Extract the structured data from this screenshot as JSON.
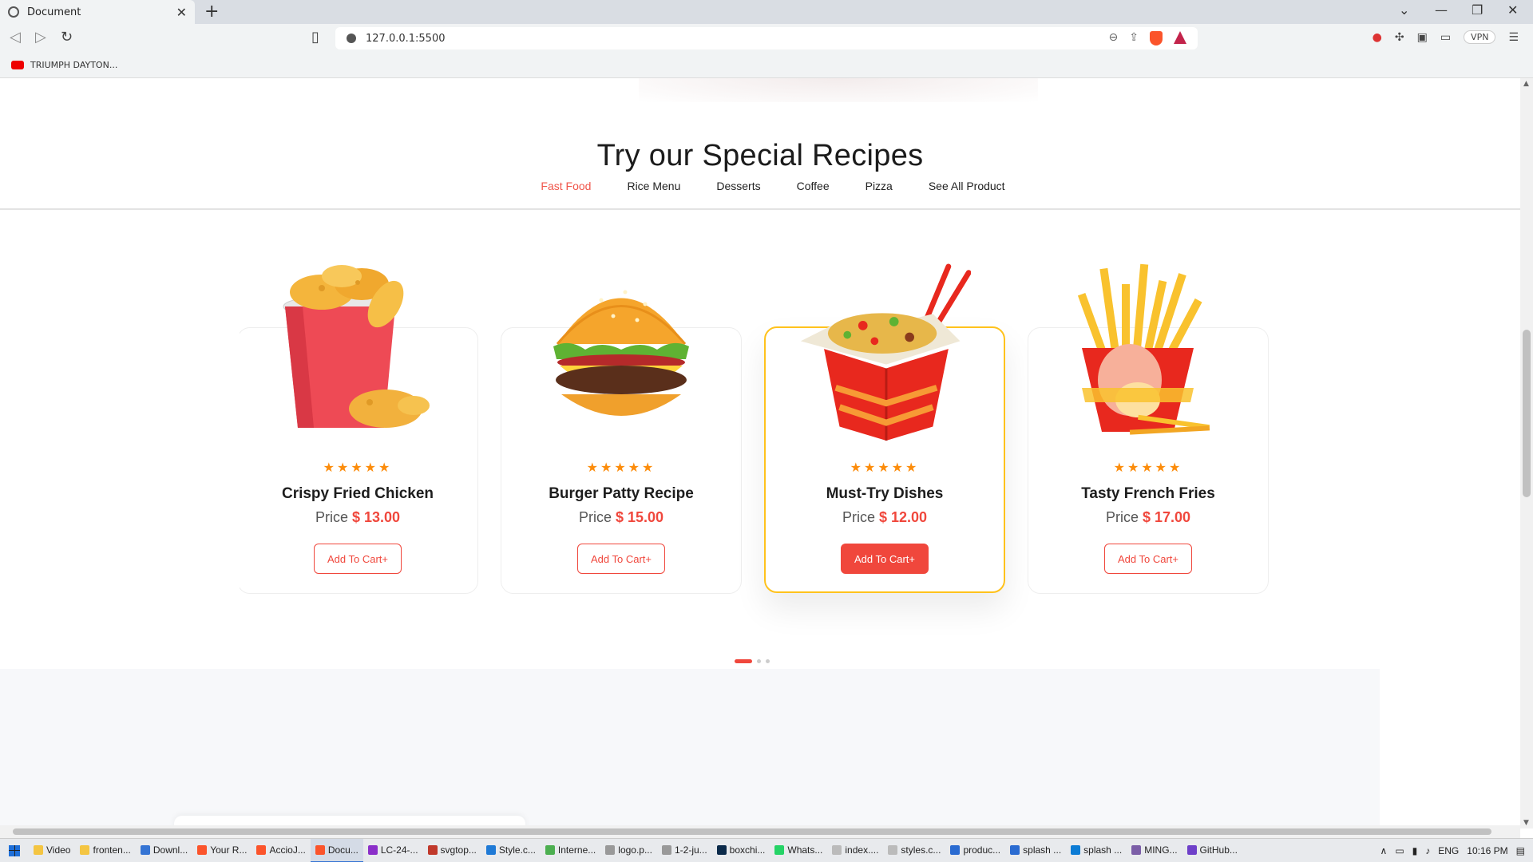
{
  "browser": {
    "tab_title": "Document",
    "url": "127.0.0.1:5500",
    "vpn_label": "VPN",
    "bookmark": "TRIUMPH DAYTON..."
  },
  "section": {
    "title": "Try our Special Recipes",
    "filters": [
      {
        "label": "Fast Food",
        "active": true
      },
      {
        "label": "Rice Menu",
        "active": false
      },
      {
        "label": "Desserts",
        "active": false
      },
      {
        "label": "Coffee",
        "active": false
      },
      {
        "label": "Pizza",
        "active": false
      },
      {
        "label": "See All Product",
        "active": false
      }
    ]
  },
  "products": [
    {
      "name": "Crispy Fried Chicken",
      "price_label": "Price",
      "price": "$ 13.00",
      "rating": 5,
      "button": "Add To Cart+",
      "image": "fried-chicken-bucket"
    },
    {
      "name": "Burger Patty Recipe",
      "price_label": "Price",
      "price": "$ 15.00",
      "rating": 5,
      "button": "Add To Cart+",
      "image": "burger"
    },
    {
      "name": "Must-Try Dishes",
      "price_label": "Price",
      "price": "$ 12.00",
      "rating": 5,
      "button": "Add To Cart+",
      "image": "noodle-box"
    },
    {
      "name": "Tasty French Fries",
      "price_label": "Price",
      "price": "$ 17.00",
      "rating": 5,
      "button": "Add To Cart+",
      "image": "french-fries"
    }
  ],
  "carousel": {
    "pages": 3,
    "active": 0
  },
  "taskbar": {
    "items": [
      "Video",
      "fronten...",
      "Downl...",
      "Your R...",
      "AccioJ...",
      "Docu...",
      "LC-24-...",
      "svgtop...",
      "Style.c...",
      "Interne...",
      "logo.p...",
      "1-2-ju...",
      "boxchi...",
      "Whats...",
      "index....",
      "styles.c...",
      "produc...",
      "splash ...",
      "splash ...",
      "MING...",
      "GitHub..."
    ],
    "active_index": 5,
    "lang": "ENG",
    "time": "10:16 PM"
  },
  "colors": {
    "accent": "#f0473c",
    "star": "#fc8c0b",
    "featured_border": "#ffc21c"
  }
}
